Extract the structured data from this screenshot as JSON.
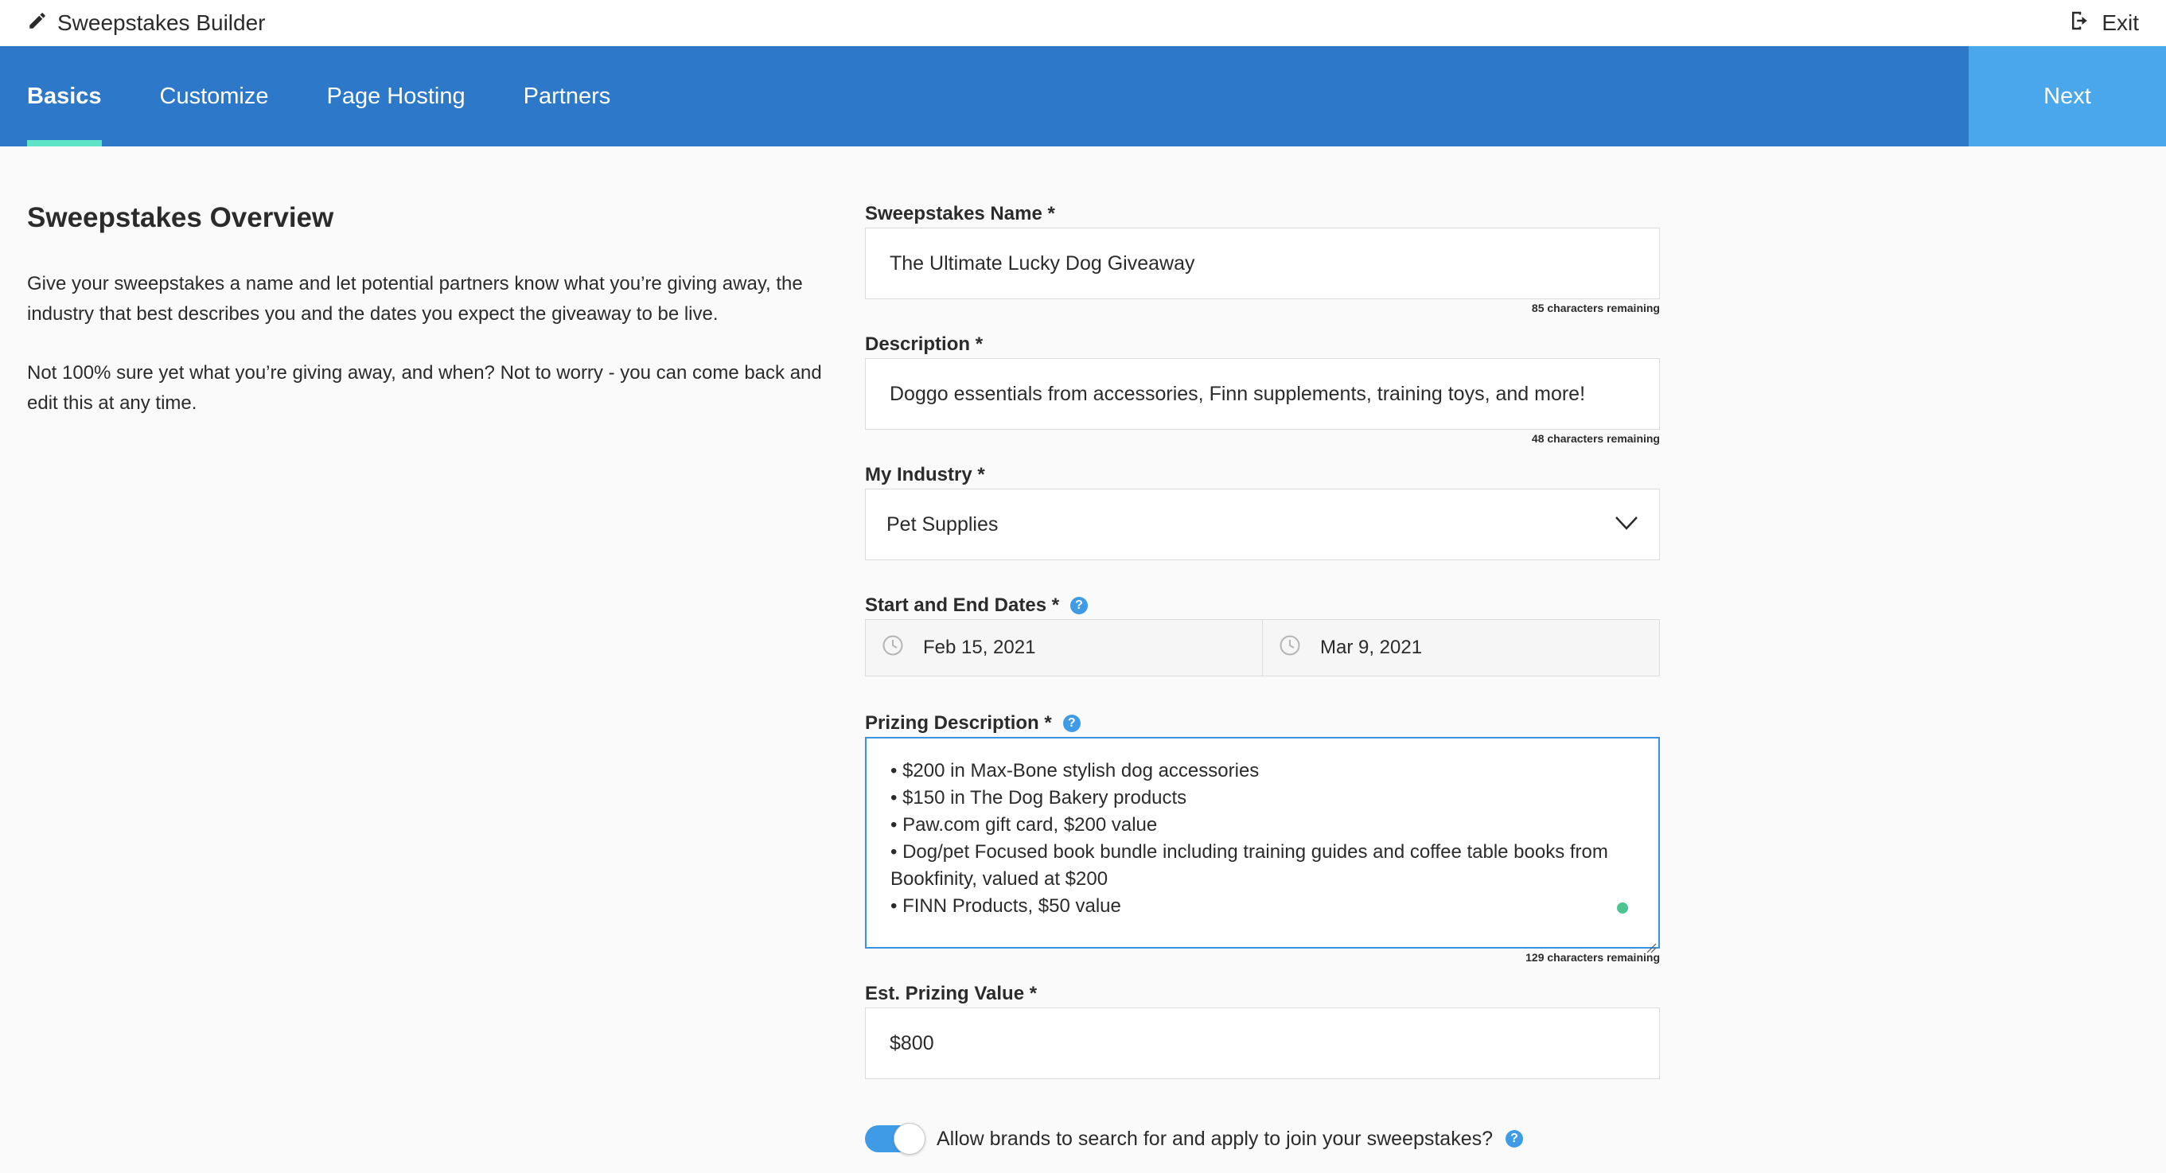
{
  "app": {
    "title": "Sweepstakes Builder",
    "exit_label": "Exit"
  },
  "nav": {
    "tabs": [
      {
        "label": "Basics",
        "active": true
      },
      {
        "label": "Customize",
        "active": false
      },
      {
        "label": "Page Hosting",
        "active": false
      },
      {
        "label": "Partners",
        "active": false
      }
    ],
    "next_label": "Next"
  },
  "overview": {
    "heading": "Sweepstakes Overview",
    "paragraphs": [
      "Give your sweepstakes a name and let potential partners know what you’re giving away, the industry that best describes you and the dates you expect the giveaway to be live.",
      "Not 100% sure yet what you’re giving away, and when? Not to worry - you can come back and edit this at any time."
    ]
  },
  "form": {
    "name": {
      "label": "Sweepstakes Name *",
      "value": "The Ultimate Lucky Dog Giveaway",
      "remaining": "85 characters remaining"
    },
    "description": {
      "label": "Description *",
      "value": "Doggo essentials from accessories, Finn supplements, training toys, and more!",
      "remaining": "48 characters remaining"
    },
    "industry": {
      "label": "My Industry *",
      "value": "Pet Supplies"
    },
    "dates": {
      "label": "Start and End Dates *",
      "start": "Feb 15, 2021",
      "end": "Mar 9, 2021"
    },
    "prizing": {
      "label": "Prizing Description *",
      "lines": [
        "• $200 in Max-Bone stylish dog accessories",
        "• $150 in The Dog Bakery products",
        "• Paw.com gift card, $200 value",
        "• Dog/pet Focused book bundle including training guides and coffee table books from Bookfinity, valued at $200",
        "• FINN Products, $50 value"
      ],
      "remaining": "129 characters remaining"
    },
    "value": {
      "label": "Est. Prizing Value *",
      "value": "$800"
    },
    "allow_brands": {
      "label": "Allow brands to search for and apply to join your sweepstakes?",
      "enabled": true
    }
  },
  "colors": {
    "nav_bg": "#2d78c8",
    "next_bg": "#4aa7ec",
    "active_underline": "#5de3c6",
    "help_blue": "#3f9be6"
  }
}
